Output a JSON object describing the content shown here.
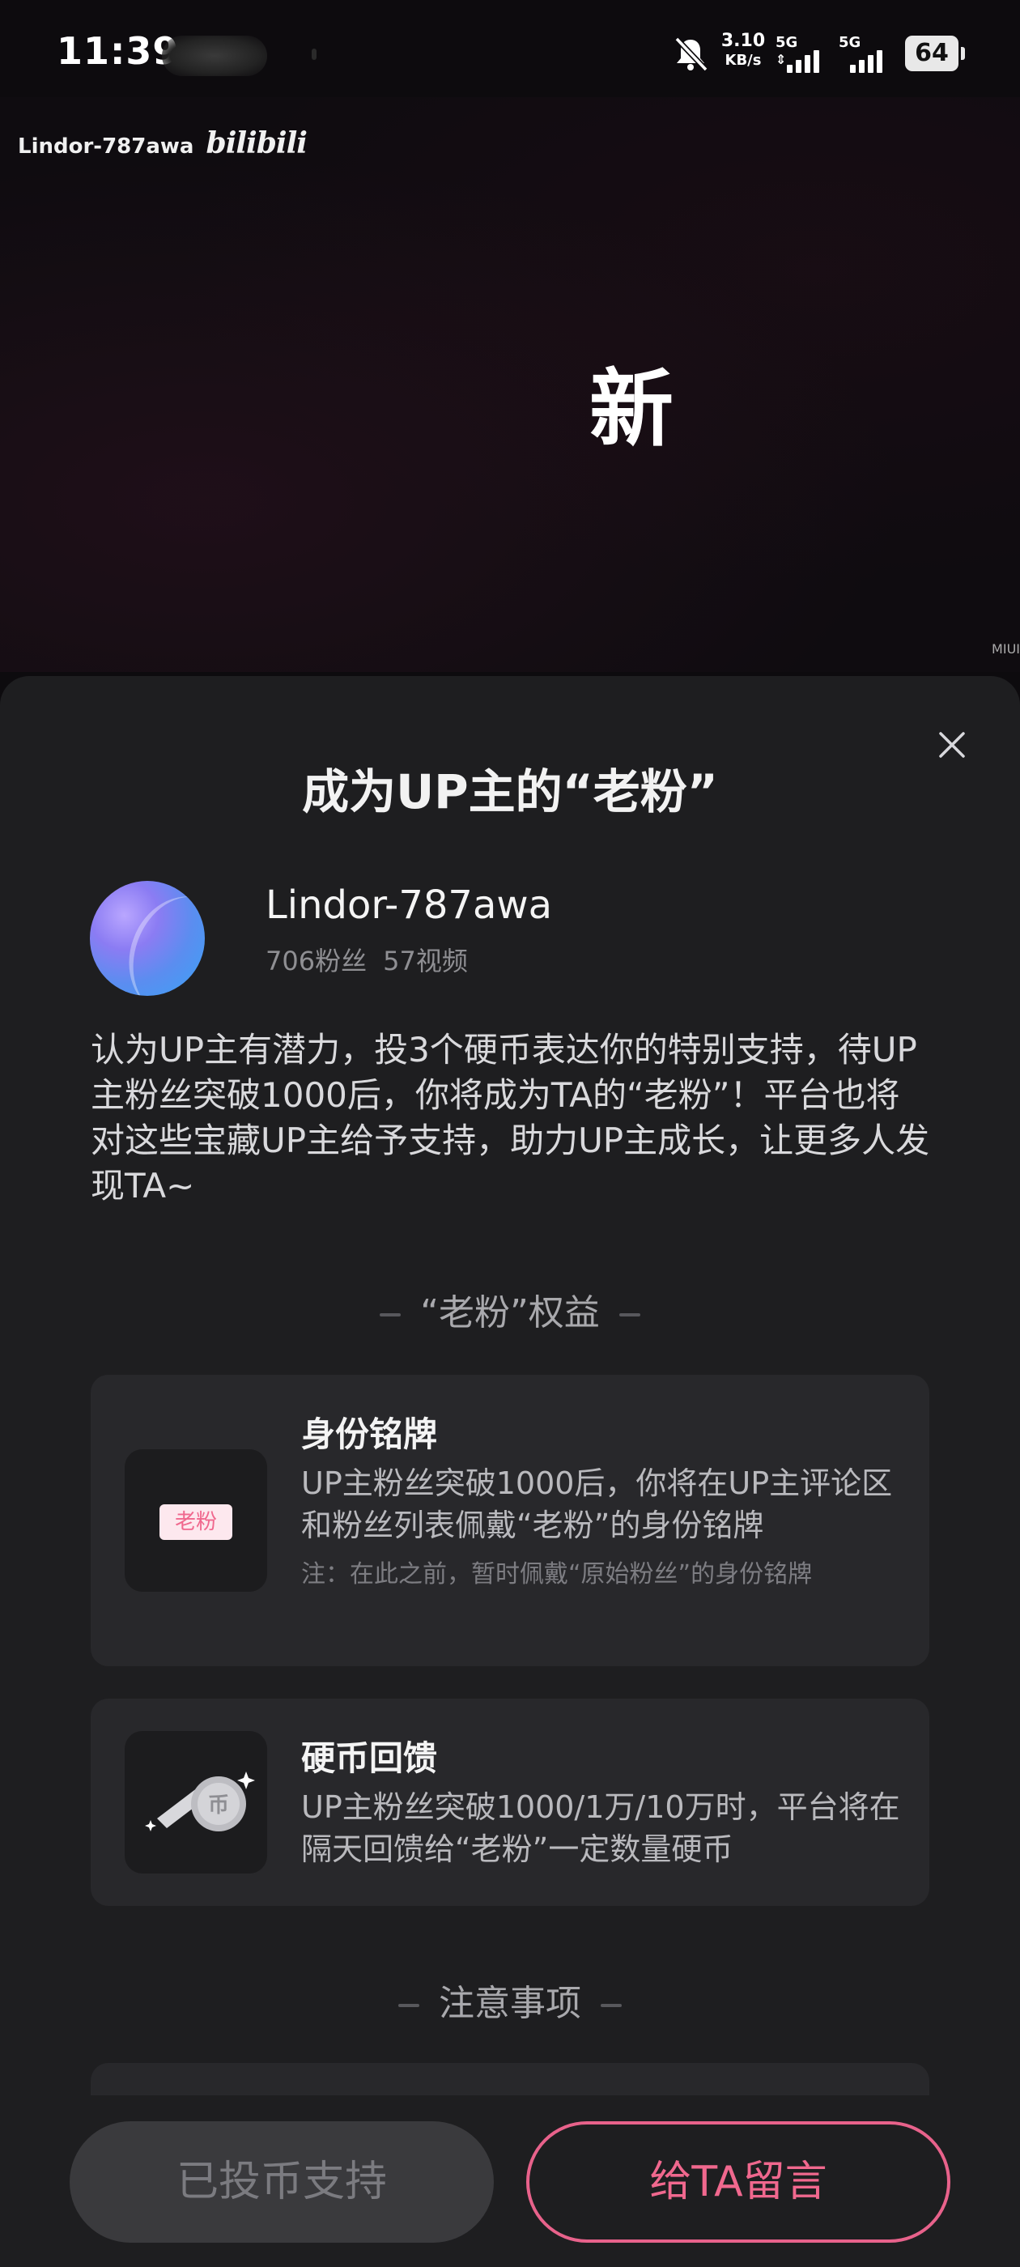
{
  "status_bar": {
    "time": "11:39",
    "net_speed_value": "3.10",
    "net_speed_unit": "KB/s",
    "sim1": "5G",
    "sim2": "5G",
    "battery": "64"
  },
  "video": {
    "watermark_user": "Lindor-787awa",
    "watermark_logo": "bilibili",
    "center_text": "新",
    "corner_mark": "MIUI",
    "progress": 0.05,
    "accent_color": "#fb7299"
  },
  "sheet": {
    "title": "成为UP主的“老粉”",
    "up_name": "Lindor-787awa",
    "fans": "706粉丝",
    "videos": "57视频",
    "description": "认为UP主有潜力，投3个硬币表达你的特别支持，待UP主粉丝突破1000后，你将成为TA的“老粉”！平台也将对这些宝藏UP主给予支持，助力UP主成长，让更多人发现TA~",
    "benefits_heading": "“老粉”权益",
    "benefits": [
      {
        "title": "身份铭牌",
        "badge": "老粉",
        "text": "UP主粉丝突破1000后，你将在UP主评论区和粉丝列表佩戴“老粉”的身份铭牌",
        "note": "注：在此之前，暂时佩戴“原始粉丝”的身份铭牌"
      },
      {
        "title": "硬币回馈",
        "text": "UP主粉丝突破1000/1万/10万时，平台将在隔天回馈给“老粉”一定数量硬币"
      }
    ],
    "notice_heading": "注意事项"
  },
  "actions": {
    "supported_label": "已投币支持",
    "message_label": "给TA留言"
  },
  "icons": {
    "close": "close-icon",
    "bell_muted": "bell-muted-icon",
    "coin": "coin-icon"
  }
}
